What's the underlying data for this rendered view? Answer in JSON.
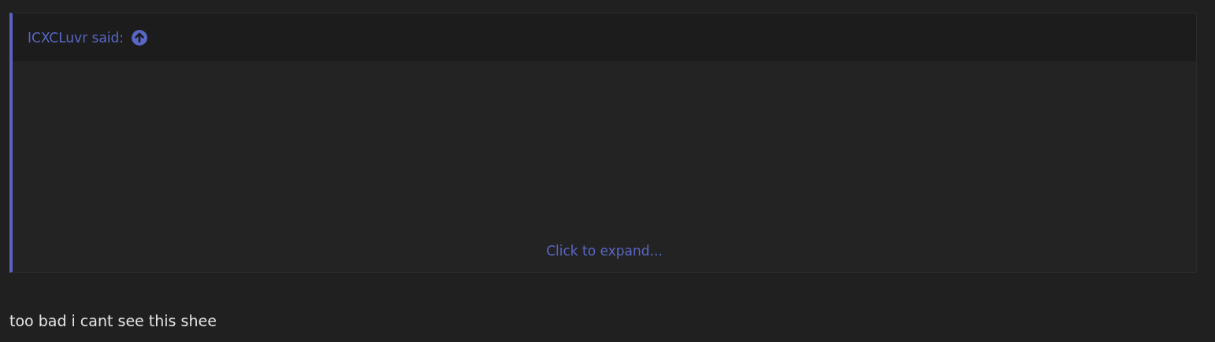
{
  "quote": {
    "author_line": "ICXCLuvr said:",
    "expand_link": "Click to expand..."
  },
  "message": "too bad i cant see this shee"
}
